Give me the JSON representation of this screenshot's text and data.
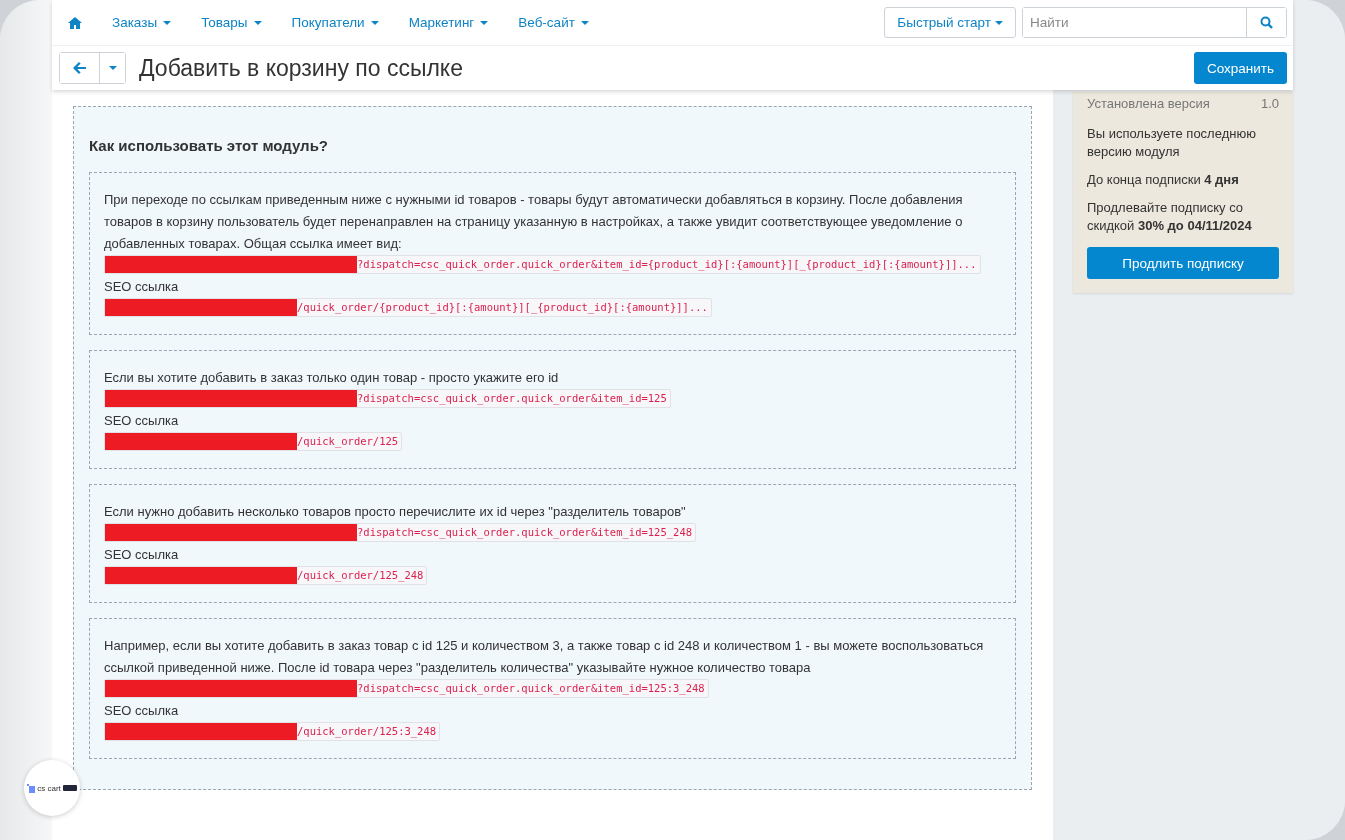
{
  "nav": {
    "items": [
      {
        "label": "Заказы"
      },
      {
        "label": "Товары"
      },
      {
        "label": "Покупатели"
      },
      {
        "label": "Маркетинг"
      },
      {
        "label": "Веб-сайт"
      }
    ],
    "quick_start": "Быстрый старт",
    "search": {
      "placeholder": "Найти"
    }
  },
  "toolbar": {
    "title": "Добавить в корзину по ссылке",
    "save_button": "Сохранить"
  },
  "help": {
    "heading": "Как использовать этот модуль?",
    "sections": [
      {
        "lines": [
          {
            "kind": "text",
            "text": "При переходе по ссылкам приведенным ниже с нужными id товаров - товары будут автоматически добавляться в корзину. После добавления товаров в корзину пользователь будет перенаправлен на страницу указанную в настройках, а также увидит соответствующее уведомление о добавленных товарах. Общая ссылка имеет вид:"
          },
          {
            "kind": "url",
            "redacted": true,
            "text": "?dispatch=csc_quick_order.quick_order&item_id={product_id}[:{amount}][_{product_id}[:{amount}]]..."
          },
          {
            "kind": "text",
            "text": "SEO ссылка"
          },
          {
            "kind": "seo_url",
            "redacted": true,
            "text": "/quick_order/{product_id}[:{amount}][_{product_id}[:{amount}]]..."
          }
        ]
      },
      {
        "lines": [
          {
            "kind": "text",
            "text": "Если вы хотите добавить в заказ только один товар - просто укажите его id"
          },
          {
            "kind": "url",
            "redacted": true,
            "text": "?dispatch=csc_quick_order.quick_order&item_id=125"
          },
          {
            "kind": "text",
            "text": "SEO ссылка"
          },
          {
            "kind": "seo_url",
            "redacted": true,
            "text": "/quick_order/125"
          }
        ]
      },
      {
        "lines": [
          {
            "kind": "text",
            "text": "Если нужно добавить несколько товаров просто перечислите их id через \"разделитель товаров\""
          },
          {
            "kind": "url",
            "redacted": true,
            "text": "?dispatch=csc_quick_order.quick_order&item_id=125_248"
          },
          {
            "kind": "text",
            "text": "SEO ссылка"
          },
          {
            "kind": "seo_url",
            "redacted": true,
            "text": "/quick_order/125_248"
          }
        ]
      },
      {
        "lines": [
          {
            "kind": "text",
            "text": "Например, если вы хотите добавить в заказ товар с id 125 и количеством 3, а также товар с id 248 и количеством 1 - вы можете воспользоваться ссылкой приведенной ниже. После id товара через \"разделитель количества\" указывайте нужное количество товара"
          },
          {
            "kind": "url",
            "redacted": true,
            "text": "?dispatch=csc_quick_order.quick_order&item_id=125:3_248"
          },
          {
            "kind": "text",
            "text": "SEO ссылка"
          },
          {
            "kind": "seo_url",
            "redacted": true,
            "text": "/quick_order/125:3_248"
          }
        ]
      }
    ]
  },
  "sidebar": {
    "version_label": "Установлена версия",
    "version": "1.0",
    "notes": [
      "Вы используете последнюю версию модуля",
      "До конца подписки **4 дня**",
      "Продлевайте подписку со скидкой **30% до 04/11/2024**"
    ],
    "renew_button": "Продлить подписку"
  },
  "badge": {
    "logo": "cs cart"
  }
}
